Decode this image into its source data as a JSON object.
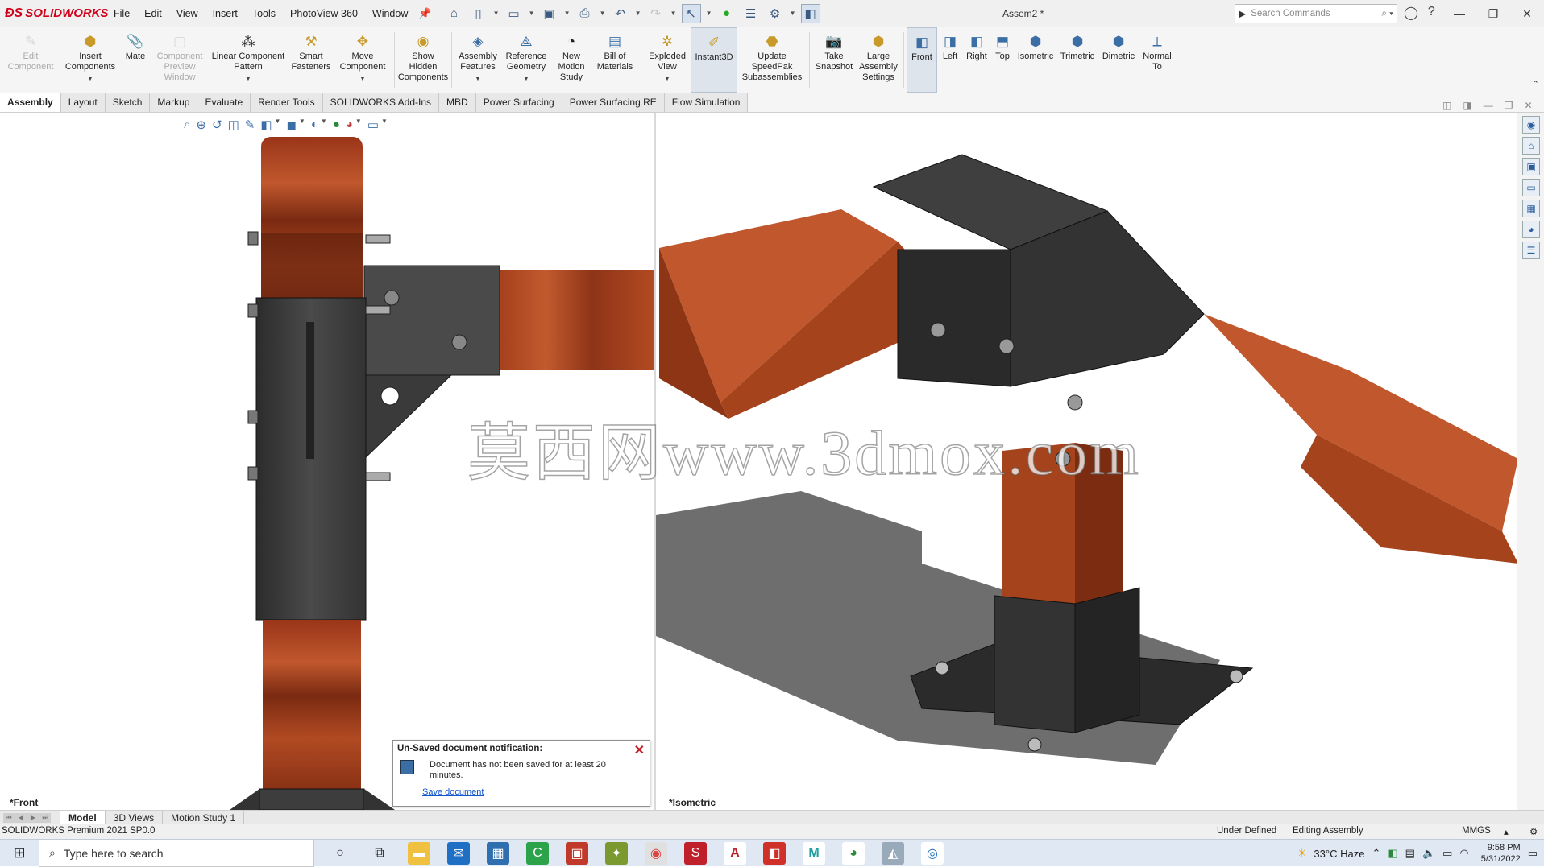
{
  "app": {
    "brand": "SOLIDWORKS",
    "doc_title": "Assem2 *",
    "menus": [
      "File",
      "Edit",
      "View",
      "Insert",
      "Tools",
      "PhotoView 360",
      "Window"
    ],
    "search_placeholder": "Search Commands"
  },
  "ribbon": {
    "buttons": [
      {
        "label": "Edit Component",
        "icon": "edit-component-icon"
      },
      {
        "label": "Insert Components",
        "icon": "insert-components-icon"
      },
      {
        "label": "Mate",
        "icon": "mate-icon"
      },
      {
        "label": "Component Preview Window",
        "icon": "component-preview-icon"
      },
      {
        "label": "Linear Component Pattern",
        "icon": "linear-pattern-icon"
      },
      {
        "label": "Smart Fasteners",
        "icon": "smart-fasteners-icon"
      },
      {
        "label": "Move Component",
        "icon": "move-component-icon"
      },
      {
        "label": "Show Hidden Components",
        "icon": "show-hidden-icon"
      },
      {
        "label": "Assembly Features",
        "icon": "assembly-features-icon"
      },
      {
        "label": "Reference Geometry",
        "icon": "reference-geometry-icon"
      },
      {
        "label": "New Motion Study",
        "icon": "motion-study-icon"
      },
      {
        "label": "Bill of Materials",
        "icon": "bom-icon"
      },
      {
        "label": "Exploded View",
        "icon": "exploded-view-icon"
      },
      {
        "label": "Instant3D",
        "icon": "instant3d-icon"
      },
      {
        "label": "Update SpeedPak Subassemblies",
        "icon": "speedpak-icon"
      },
      {
        "label": "Take Snapshot",
        "icon": "camera-icon"
      },
      {
        "label": "Large Assembly Settings",
        "icon": "large-assembly-icon"
      },
      {
        "label": "Front",
        "icon": "front-view-icon"
      },
      {
        "label": "Left",
        "icon": "left-view-icon"
      },
      {
        "label": "Right",
        "icon": "right-view-icon"
      },
      {
        "label": "Top",
        "icon": "top-view-icon"
      },
      {
        "label": "Isometric",
        "icon": "isometric-icon"
      },
      {
        "label": "Trimetric",
        "icon": "trimetric-icon"
      },
      {
        "label": "Dimetric",
        "icon": "dimetric-icon"
      },
      {
        "label": "Normal To",
        "icon": "normal-to-icon"
      }
    ]
  },
  "tabs": [
    "Assembly",
    "Layout",
    "Sketch",
    "Markup",
    "Evaluate",
    "Render Tools",
    "SOLIDWORKS Add-Ins",
    "MBD",
    "Power Surfacing",
    "Power Surfacing RE",
    "Flow Simulation"
  ],
  "viewports": {
    "left_label": "*Front",
    "right_label": "*Isometric"
  },
  "watermark": "莫西网www.3dmox.com",
  "notification": {
    "title": "Un-Saved document notification:",
    "body": "Document has not been saved for at least 20 minutes.",
    "link": "Save document"
  },
  "bottom_tabs": [
    "Model",
    "3D Views",
    "Motion Study 1"
  ],
  "status": {
    "product": "SOLIDWORKS Premium 2021 SP0.0",
    "state": "Under Defined",
    "mode": "Editing Assembly",
    "units": "MMGS"
  },
  "taskbar": {
    "search_placeholder": "Type here to search",
    "weather": "33°C  Haze",
    "time": "9:58 PM",
    "date": "5/31/2022"
  }
}
